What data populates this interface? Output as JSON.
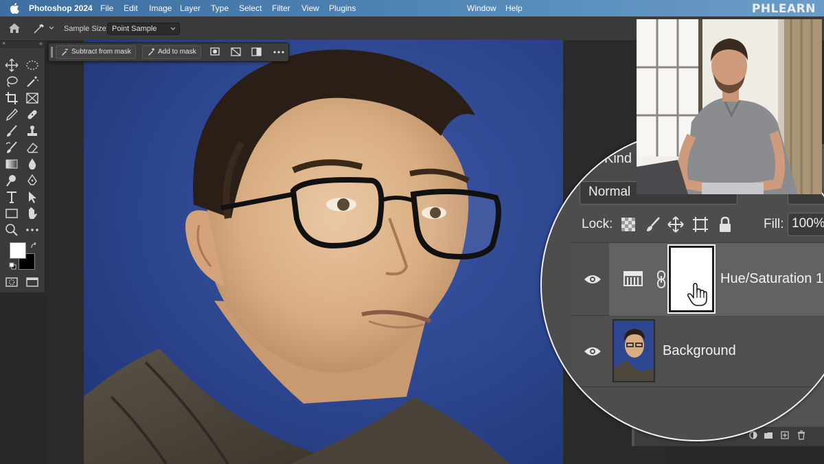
{
  "menubar": {
    "app_name": "Photoshop 2024",
    "items": [
      "File",
      "Edit",
      "Image",
      "Layer",
      "Type",
      "Select",
      "Filter",
      "View",
      "Plugins"
    ],
    "right_items": [
      "Window",
      "Help"
    ],
    "logo": "PHLEARN"
  },
  "options_bar": {
    "sample_size_label": "Sample Size:",
    "sample_size_value": "Point Sample"
  },
  "context_bar": {
    "subtract_label": "Subtract from mask",
    "add_label": "Add to mask"
  },
  "layers": {
    "filter_kind_label": "Kind",
    "blend_mode": "Normal",
    "lock_label": "Lock:",
    "fill_label": "Fill:",
    "fill_value": "100%",
    "items": [
      {
        "name": "Hue/Saturation 1",
        "type": "adjustment"
      },
      {
        "name": "Background",
        "type": "pixel"
      }
    ]
  },
  "colors": {
    "menubar_accent": "#4b7fb0",
    "panel_bg": "#535353",
    "photo_bg": "#2d4690"
  }
}
